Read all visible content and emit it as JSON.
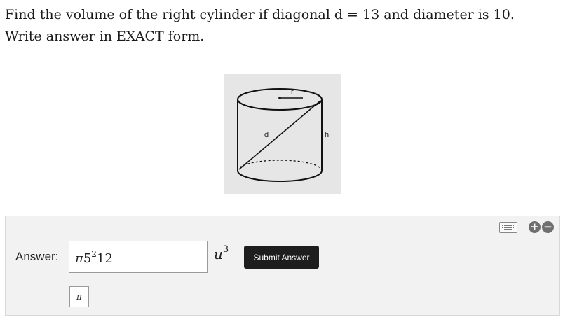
{
  "question": {
    "text": "Find the volume of the right cylinder if diagonal d = 13 and diameter is 10. Write answer in EXACT form."
  },
  "figure": {
    "label_r": "r",
    "label_d": "d",
    "label_h": "h"
  },
  "answer": {
    "label": "Answer:",
    "value_pi": "π",
    "value_base": "5",
    "value_exp": "2",
    "value_factor": "12",
    "units_var": "u",
    "units_exp": "3",
    "submit_label": "Submit Answer",
    "pi_button_label": "π"
  },
  "tools": {
    "plus_icon": "plus-icon",
    "minus_icon": "minus-icon",
    "keyboard_icon": "keyboard-icon"
  }
}
